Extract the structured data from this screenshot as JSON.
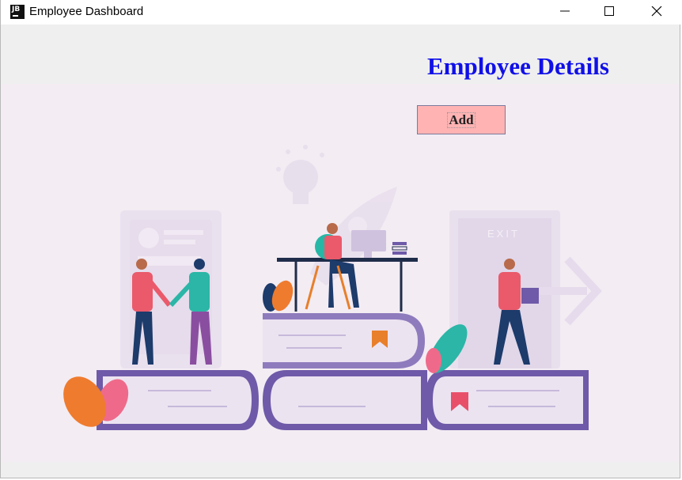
{
  "window": {
    "app_icon": "JB",
    "title": "Employee Dashboard"
  },
  "main": {
    "heading": "Employee Details",
    "add_label": "Add"
  },
  "illustration": {
    "exit_sign": "EXIT"
  },
  "colors": {
    "heading": "#1010e8",
    "add_button": "#ffb3b3",
    "book_purple": "#6e5aa8",
    "background": "#f3ecf3"
  }
}
